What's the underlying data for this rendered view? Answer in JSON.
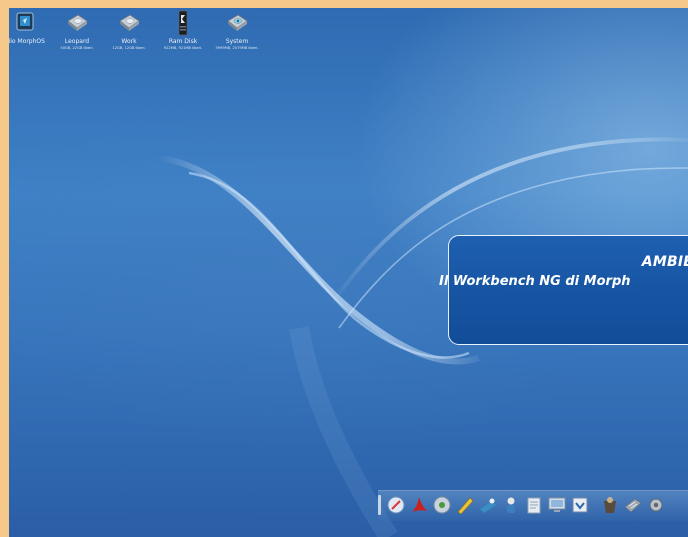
{
  "desktop_icons": [
    {
      "label": "Mio MorphOS",
      "sub": "",
      "icon": "computer-icon"
    },
    {
      "label": "Leopard",
      "sub": "50GB, 22GB liberi.",
      "icon": "hard-disk-icon"
    },
    {
      "label": "Work",
      "sub": "12GB, 12GB liberi.",
      "icon": "hard-disk-icon"
    },
    {
      "label": "Ram Disk",
      "sub": "922MB, 921MB liberi.",
      "icon": "memory-icon"
    },
    {
      "label": "System",
      "sub": "5999MB, 2579MB liberi.",
      "icon": "hard-disk-icon"
    }
  ],
  "banner": {
    "line1": "AMBIE",
    "line2": "Il Workbench NG di Morph"
  },
  "dock": {
    "items": [
      {
        "name": "browser-icon"
      },
      {
        "name": "pdf-reader-icon"
      },
      {
        "name": "media-player-icon"
      },
      {
        "name": "pencil-icon"
      },
      {
        "name": "paint-icon"
      },
      {
        "name": "character-icon"
      },
      {
        "name": "text-editor-icon"
      },
      {
        "name": "monitor-icon"
      },
      {
        "name": "download-icon"
      },
      {
        "name": "games-icon"
      },
      {
        "name": "keyboard-icon"
      },
      {
        "name": "settings-icon"
      }
    ]
  },
  "colors": {
    "frame": "#f6c98a",
    "desktop": "#3f81c6",
    "banner": "#1a58a8"
  }
}
